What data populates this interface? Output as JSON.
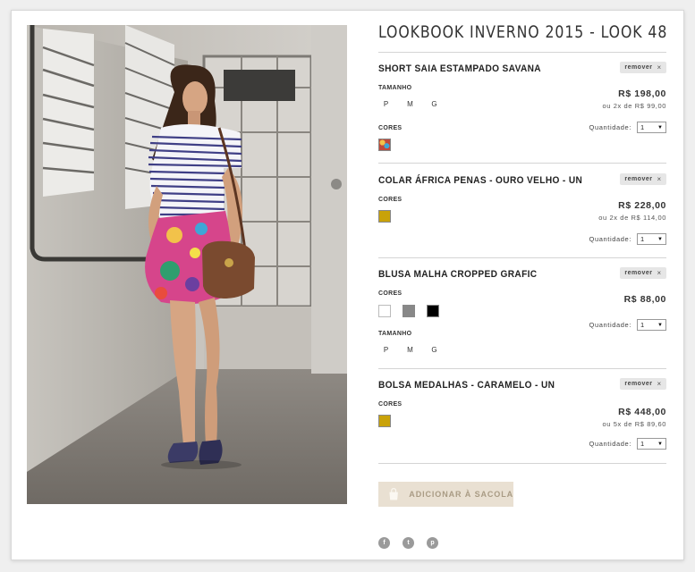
{
  "look": {
    "title": "LOOKBOOK INVERNO 2015 - LOOK 48"
  },
  "labels": {
    "sizes": "TAMANHO",
    "colors": "CORES",
    "quantity": "Quantidade:",
    "remove": "remover",
    "remove_x": "×"
  },
  "products": [
    {
      "name": "SHORT SAIA ESTAMPADO SAVANA",
      "price": "R$ 198,00",
      "installment": "ou 2x de R$ 99,00",
      "sizes": [
        "P",
        "M",
        "G"
      ],
      "colors": [
        "#c2493a"
      ],
      "quantity": "1"
    },
    {
      "name": "COLAR ÁFRICA PENAS - OURO VELHO - UN",
      "price": "R$ 228,00",
      "installment": "ou 2x de R$ 114,00",
      "colors": [
        "#c9a209"
      ],
      "quantity": "1"
    },
    {
      "name": "BLUSA MALHA CROPPED GRAFIC",
      "price": "R$ 88,00",
      "sizes": [
        "P",
        "M",
        "G"
      ],
      "colors": [
        "#ffffff",
        "#888888",
        "#000000"
      ],
      "quantity": "1"
    },
    {
      "name": "BOLSA MEDALHAS - CARAMELO - UN",
      "price": "R$ 448,00",
      "installment": "ou 5x de R$ 89,60",
      "colors": [
        "#c9a209"
      ],
      "quantity": "1"
    }
  ],
  "cart": {
    "add_label": "ADICIONAR À SACOLA"
  },
  "social": [
    {
      "name": "facebook",
      "glyph": "f"
    },
    {
      "name": "twitter",
      "glyph": "t"
    },
    {
      "name": "pinterest",
      "glyph": "p"
    }
  ],
  "colors": {
    "accent_bg": "#e9e0d2",
    "accent_text": "#a99b84"
  }
}
